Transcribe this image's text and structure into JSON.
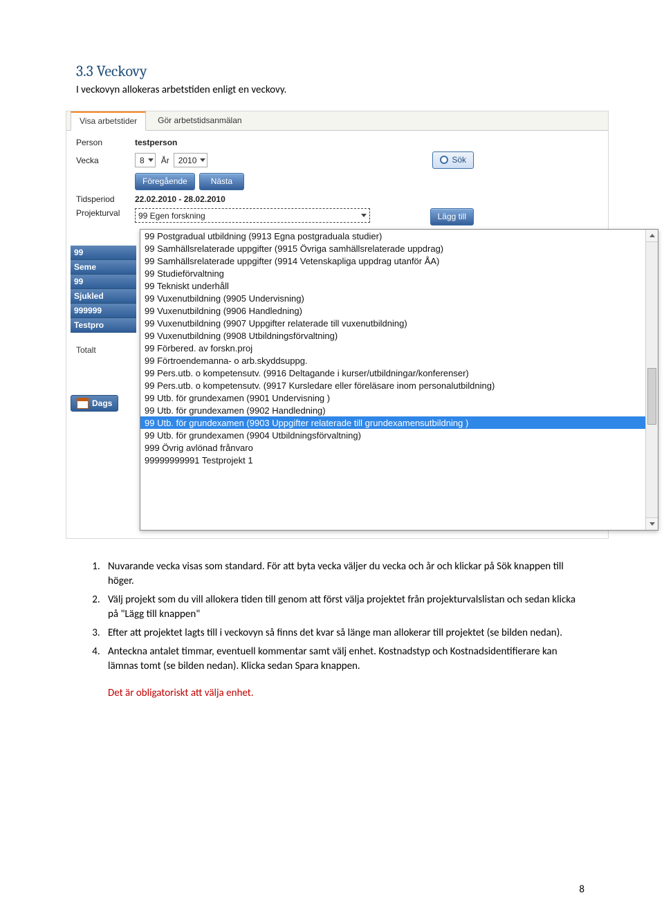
{
  "heading": "3.3 Veckovy",
  "intro": "I veckovyn allokeras arbetstiden enligt en veckovy.",
  "screenshot": {
    "tabs": {
      "active": "Visa arbetstider",
      "inactive": "Gör arbetstidsanmälan"
    },
    "labels": {
      "person": "Person",
      "vecka": "Vecka",
      "ar": "År",
      "tidsperiod": "Tidsperiod",
      "projekturval": "Projekturval",
      "totalt": "Totalt"
    },
    "values": {
      "person": "testperson",
      "vecka": "8",
      "ar": "2010",
      "tidsperiod": "22.02.2010 - 28.02.2010",
      "projekturval": "99 Egen forskning"
    },
    "buttons": {
      "sok": "Sök",
      "foregaende": "Föregående",
      "nasta": "Nästa",
      "lagg_till": "Lägg till",
      "dags": "Dags"
    },
    "side_rows": [
      "99",
      "Seme",
      "99",
      "Sjukled",
      "999999",
      "Testpro"
    ],
    "dropdown": [
      "99 Postgradual utbildning (9913 Egna postgraduala studier)",
      "99 Samhällsrelaterade uppgifter (9915 Övriga samhällsrelaterade uppdrag)",
      "99 Samhällsrelaterade uppgifter (9914 Vetenskapliga uppdrag utanför ÅA)",
      "99 Studieförvaltning",
      "99 Tekniskt underhåll",
      "99 Vuxenutbildning (9905 Undervisning)",
      "99 Vuxenutbildning (9906 Handledning)",
      "99 Vuxenutbildning (9907 Uppgifter relaterade till vuxenutbildning)",
      "99 Vuxenutbildning (9908 Utbildningsförvaltning)",
      "99 Förbered. av forskn.proj",
      "99 Förtroendemanna- o arb.skyddsuppg.",
      "99 Pers.utb. o kompetensutv. (9916 Deltagande i kurser/utbildningar/konferenser)",
      "99 Pers.utb. o kompetensutv. (9917 Kursledare eller föreläsare inom personalutbildning)",
      "99 Utb. för grundexamen (9901 Undervisning )",
      "99 Utb. för grundexamen (9902 Handledning)",
      "99 Utb. för grundexamen (9903 Uppgifter relaterade till grundexamensutbildning )",
      "99 Utb. för grundexamen (9904 Utbildningsförvaltning)",
      "999 Övrig avlönad frånvaro",
      "99999999991 Testprojekt 1"
    ],
    "dropdown_selected_index": 15
  },
  "steps": [
    "Nuvarande vecka visas som standard. För att byta vecka väljer du vecka och år och klickar på Sök knappen till höger.",
    "Välj projekt som du vill allokera tiden till genom att först välja projektet från projekturvalslistan och sedan klicka på \"Lägg till knappen\"",
    "Efter att projektet lagts till i veckovyn så finns det kvar så länge man allokerar till projektet (se bilden nedan).",
    "Anteckna antalet timmar, eventuell kommentar samt välj enhet. Kostnadstyp och Kostnadsidentifierare kan lämnas tomt (se bilden nedan). Klicka sedan Spara knappen."
  ],
  "red_note": "Det är obligatoriskt att välja enhet.",
  "page_number": "8"
}
